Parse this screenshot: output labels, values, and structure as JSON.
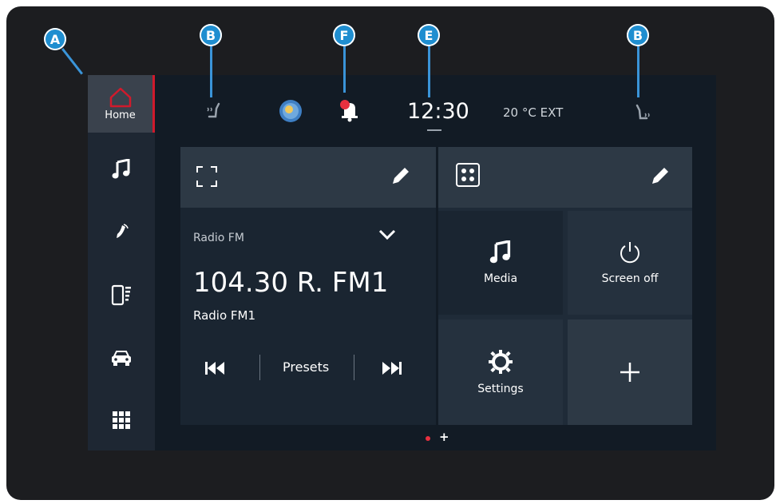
{
  "callouts": {
    "a": "A",
    "b_left": "B",
    "f": "F",
    "e": "E",
    "b_right": "B"
  },
  "sidebar": {
    "home_label": "Home",
    "items": [
      "home-icon",
      "music-note-icon",
      "phone-icon",
      "smartphone-projection-icon",
      "car-icon",
      "apps-grid-icon"
    ]
  },
  "topbar": {
    "time": "12:30",
    "temperature": "20 °C EXT"
  },
  "radio_card": {
    "source": "Radio FM",
    "frequency": "104.30 R. FM1",
    "station": "Radio FM1",
    "presets_label": "Presets"
  },
  "shortcuts_card": {
    "tiles": [
      {
        "label": "Media",
        "icon": "music-note-icon"
      },
      {
        "label": "Screen off",
        "icon": "power-icon"
      },
      {
        "label": "Settings",
        "icon": "gear-icon"
      },
      {
        "label": "",
        "icon": "plus-icon"
      }
    ]
  },
  "pagination": {
    "active_dot_color": "#e8303f",
    "add_symbol": "+"
  },
  "colors": {
    "accent": "#d01a2c",
    "callout": "#1f8ed0",
    "screen_bg": "#121b25"
  }
}
